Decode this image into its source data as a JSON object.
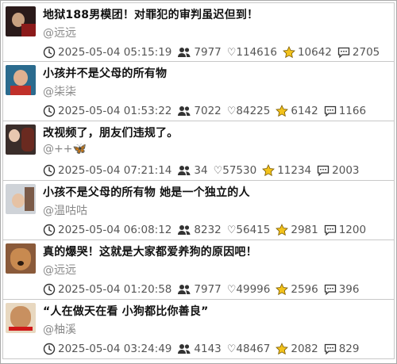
{
  "items": [
    {
      "title": "地狱188男模团！对罪犯的审判虽迟但到！",
      "author": "@远远",
      "time": "2025-05-04 05:15:19",
      "viewers": "7977",
      "likes": "114616",
      "stars": "10642",
      "comments": "2705",
      "thumb": {
        "bg": "#2a1a1a",
        "c1": "#c8a080",
        "c2": "#8b1a1a"
      }
    },
    {
      "title": "小孩并不是父母的所有物",
      "author": "@柒柒",
      "time": "2025-05-04 01:53:22",
      "viewers": "7022",
      "likes": "84225",
      "stars": "6142",
      "comments": "1166",
      "thumb": {
        "bg": "#2b6b8e",
        "c1": "#e0b090",
        "c2": "#c0302a"
      }
    },
    {
      "title": "改视频了，朋友们违规了。",
      "author": "@++🦋",
      "time": "2025-05-04 07:21:14",
      "viewers": "34",
      "likes": "57530",
      "stars": "11234",
      "comments": "2003",
      "thumb": {
        "bg": "#3a2d2a",
        "c1": "#e8c8b0",
        "c2": "#6a2a20"
      }
    },
    {
      "title": "小孩不是父母的所有物 她是一个独立的人",
      "author": "@温咕咕",
      "time": "2025-05-04 06:08:12",
      "viewers": "8232",
      "likes": "56415",
      "stars": "2981",
      "comments": "1200",
      "thumb": {
        "bg": "#cfd3d8",
        "c1": "#e6c2a4",
        "c2": "#7a5a48"
      }
    },
    {
      "title": "真的爆哭！这就是大家都爱养狗的原因吧！",
      "author": "@远远",
      "time": "2025-05-04 01:20:58",
      "viewers": "7977",
      "likes": "49996",
      "stars": "2596",
      "comments": "396",
      "thumb": {
        "bg": "#8a5a3a",
        "c1": "#c88a50",
        "c2": "#2a1a10"
      }
    },
    {
      "title": "“人在做天在看 小狗都比你善良”",
      "author": "@柚溪",
      "time": "2025-05-04 03:24:49",
      "viewers": "4143",
      "likes": "48467",
      "stars": "2082",
      "comments": "829",
      "thumb": {
        "bg": "#e8d8c0",
        "c1": "#c89060",
        "c2": "#d01818"
      }
    }
  ]
}
